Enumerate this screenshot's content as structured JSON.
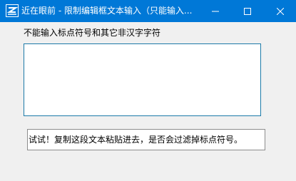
{
  "window": {
    "title": "近在眼前 - 限制编辑框文本输入（只能输入...",
    "app_icon": "app-logo-icon",
    "controls": {
      "minimize_icon": "minimize-icon",
      "maximize_icon": "maximize-icon",
      "close_icon": "close-icon"
    },
    "title_bar_color": "#0078d7"
  },
  "content": {
    "instruction_label": "不能输入标点符号和其它非汉字字符",
    "input": {
      "value": "",
      "border_color": "#1c7aa8"
    },
    "sample_text": "试试！复制这段文本粘贴进去，是否会过滤掉标点符号。"
  }
}
